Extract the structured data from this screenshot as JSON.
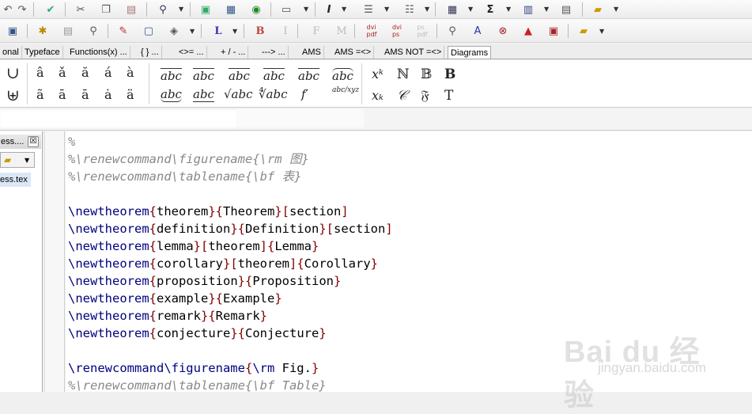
{
  "tabs": [
    "onal",
    "Typeface",
    "Functions(x) ...",
    "{ } ...",
    "<>= ...",
    "+ / - ...",
    "---> ...",
    "AMS",
    "AMS =<>",
    "AMS NOT =<>",
    "Diagrams"
  ],
  "left_panel": {
    "title": "ess....",
    "close_label": "☒",
    "file": "ess.tex"
  },
  "editor_lines": [
    [
      [
        "cmt",
        "%"
      ]
    ],
    [
      [
        "cmt",
        "%\\renewcommand\\figurename{\\rm 图}"
      ]
    ],
    [
      [
        "cmt",
        "%\\renewcommand\\tablename{\\bf 表}"
      ]
    ],
    [],
    [
      [
        "cmd",
        "\\newtheorem"
      ],
      [
        "brace",
        "{"
      ],
      [
        "arg",
        "theorem"
      ],
      [
        "brace",
        "}{"
      ],
      [
        "arg",
        "Theorem"
      ],
      [
        "brace",
        "}["
      ],
      [
        "arg",
        "section"
      ],
      [
        "brace",
        "]"
      ]
    ],
    [
      [
        "cmd",
        "\\newtheorem"
      ],
      [
        "brace",
        "{"
      ],
      [
        "arg",
        "definition"
      ],
      [
        "brace",
        "}{"
      ],
      [
        "arg",
        "Definition"
      ],
      [
        "brace",
        "}["
      ],
      [
        "arg",
        "section"
      ],
      [
        "brace",
        "]"
      ]
    ],
    [
      [
        "cmd",
        "\\newtheorem"
      ],
      [
        "brace",
        "{"
      ],
      [
        "arg",
        "lemma"
      ],
      [
        "brace",
        "}["
      ],
      [
        "arg",
        "theorem"
      ],
      [
        "brace",
        "]{"
      ],
      [
        "arg",
        "Lemma"
      ],
      [
        "brace",
        "}"
      ]
    ],
    [
      [
        "cmd",
        "\\newtheorem"
      ],
      [
        "brace",
        "{"
      ],
      [
        "arg",
        "corollary"
      ],
      [
        "brace",
        "}["
      ],
      [
        "arg",
        "theorem"
      ],
      [
        "brace",
        "]{"
      ],
      [
        "arg",
        "Corollary"
      ],
      [
        "brace",
        "}"
      ]
    ],
    [
      [
        "cmd",
        "\\newtheorem"
      ],
      [
        "brace",
        "{"
      ],
      [
        "arg",
        "proposition"
      ],
      [
        "brace",
        "}{"
      ],
      [
        "arg",
        "Proposition"
      ],
      [
        "brace",
        "}"
      ]
    ],
    [
      [
        "cmd",
        "\\newtheorem"
      ],
      [
        "brace",
        "{"
      ],
      [
        "arg",
        "example"
      ],
      [
        "brace",
        "}{"
      ],
      [
        "arg",
        "Example"
      ],
      [
        "brace",
        "}"
      ]
    ],
    [
      [
        "cmd",
        "\\newtheorem"
      ],
      [
        "brace",
        "{"
      ],
      [
        "arg",
        "remark"
      ],
      [
        "brace",
        "}{"
      ],
      [
        "arg",
        "Remark"
      ],
      [
        "brace",
        "}"
      ]
    ],
    [
      [
        "cmd",
        "\\newtheorem"
      ],
      [
        "brace",
        "{"
      ],
      [
        "arg",
        "conjecture"
      ],
      [
        "brace",
        "}{"
      ],
      [
        "arg",
        "Conjecture"
      ],
      [
        "brace",
        "}"
      ]
    ],
    [],
    [
      [
        "cmd",
        "\\renewcommand\\figurename"
      ],
      [
        "brace",
        "{"
      ],
      [
        "cmd",
        "\\rm"
      ],
      [
        "arg",
        " Fig."
      ],
      [
        "brace",
        "}"
      ]
    ],
    [
      [
        "cmt",
        "%\\renewcommand\\tablename{\\bf Table}"
      ]
    ]
  ],
  "symbols": {
    "ops": [
      "∪",
      "⊎"
    ],
    "accents_row1": [
      "â",
      "ǎ",
      "ă",
      "á",
      "à"
    ],
    "accents_row2": [
      "ã",
      "ā",
      "ā",
      "ȧ",
      "ä"
    ],
    "wide_row1": [
      "abc",
      "abc",
      "abc",
      "abc",
      "abc",
      "abc"
    ],
    "wide_row2": [
      "abc",
      "abc",
      "√abc",
      "∜abc",
      "f′",
      "abc/xyz"
    ],
    "misc_row1": [
      "xᵏ",
      "ℕ",
      "𝔹",
      "B"
    ],
    "misc_row2": [
      "xₖ",
      "𝒞",
      "𝔉",
      "T"
    ]
  },
  "toolbar2_letters": [
    "L",
    "B",
    "I",
    "F",
    "M"
  ],
  "watermark": {
    "logo": "Bai du 经验",
    "url": "jingyan.baidu.com"
  },
  "colors": {
    "command": "#000080",
    "brace": "#800000",
    "comment": "#888888",
    "selected_file": "#dbe7f7"
  }
}
